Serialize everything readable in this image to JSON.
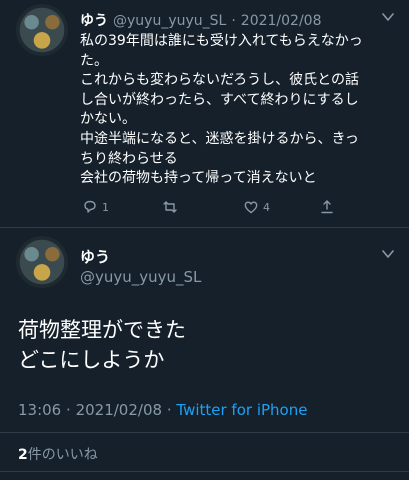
{
  "thread_tweet": {
    "display_name": "ゆう",
    "handle": "@yuyu_yuyu_SL",
    "separator": "·",
    "date": "2021/02/08",
    "lines": [
      "私の39年間は誰にも受け入れてもらえなかっ",
      "た。",
      "これからも変わらないだろうし、彼氏との話",
      "し合いが終わったら、すべて終わりにするし",
      "かない。",
      "中途半端になると、迷惑を掛けるから、きっ",
      "ちり終わらせる",
      "会社の荷物も持って帰って消えないと"
    ],
    "reply_count": "1",
    "like_count": "4"
  },
  "main_tweet": {
    "display_name": "ゆう",
    "handle": "@yuyu_yuyu_SL",
    "lines": [
      "荷物整理ができた",
      "どこにしようか"
    ],
    "time": "13:06",
    "separator": "·",
    "date": "2021/02/08",
    "source": "Twitter for iPhone",
    "like_count": "2",
    "likes_label": "件のいいね"
  },
  "icons": {
    "reply": "reply-icon",
    "retweet": "retweet-icon",
    "like": "heart-icon",
    "share": "share-icon",
    "more": "chevron-down-icon"
  },
  "colors": {
    "background": "#15202b",
    "muted": "#8899a6",
    "link": "#1da1f2",
    "divider": "#2f3b48"
  }
}
